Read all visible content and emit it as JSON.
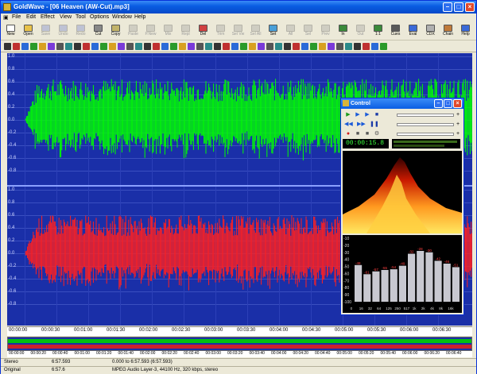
{
  "window": {
    "title": "GoldWave - [06 Heaven (AW-Cut).mp3]"
  },
  "menu": [
    "File",
    "Edit",
    "Effect",
    "View",
    "Tool",
    "Options",
    "Window",
    "Help"
  ],
  "toolbar": [
    {
      "label": "New",
      "color": "#ffffff",
      "disabled": false
    },
    {
      "label": "Open",
      "color": "#e8c24a",
      "disabled": false
    },
    {
      "label": "Save",
      "color": "#6a7ccf",
      "disabled": true
    },
    {
      "label": "Undo",
      "color": "#6a7ccf",
      "disabled": true
    },
    {
      "label": "Redo",
      "color": "#6a7ccf",
      "disabled": true
    },
    {
      "label": "Cut",
      "color": "#888888",
      "disabled": false
    },
    {
      "label": "Copy",
      "color": "#c2b36a",
      "disabled": false
    },
    {
      "label": "Paste",
      "color": "#9a9a9a",
      "disabled": true
    },
    {
      "label": "P.New",
      "color": "#9a9a9a",
      "disabled": true
    },
    {
      "label": "Mix",
      "color": "#9a9a9a",
      "disabled": true
    },
    {
      "label": "Repl",
      "color": "#9a9a9a",
      "disabled": true
    },
    {
      "label": "Del",
      "color": "#d04040",
      "disabled": false
    },
    {
      "label": "Trim",
      "color": "#9a9a9a",
      "disabled": true
    },
    {
      "label": "Sel Vw",
      "color": "#9a9a9a",
      "disabled": true
    },
    {
      "label": "Sel All",
      "color": "#9a9a9a",
      "disabled": true
    },
    {
      "label": "Set",
      "color": "#4aa0d8",
      "disabled": false
    },
    {
      "label": "All",
      "color": "#9a9a9a",
      "disabled": true
    },
    {
      "label": "Sel",
      "color": "#9a9a9a",
      "disabled": true
    },
    {
      "label": "Prev",
      "color": "#9a9a9a",
      "disabled": true
    },
    {
      "label": "In",
      "color": "#3a8a3a",
      "disabled": false
    },
    {
      "label": "Out",
      "color": "#9a9a9a",
      "disabled": true
    },
    {
      "label": "1:1",
      "color": "#3a8a3a",
      "disabled": false
    },
    {
      "label": "Cues",
      "color": "#5a5a5a",
      "disabled": false
    },
    {
      "label": "Eval",
      "color": "#3a6ad8",
      "disabled": false
    },
    {
      "label": "CDX",
      "color": "#b0b0b0",
      "disabled": false
    },
    {
      "label": "Chain",
      "color": "#c07a3a",
      "disabled": false
    },
    {
      "label": "Help",
      "color": "#3a6ad8",
      "disabled": false
    }
  ],
  "y_axis_labels": [
    "1.0",
    "0.8",
    "0.6",
    "0.4",
    "0.2",
    "0.0",
    "-0.2",
    "-0.4",
    "-0.6",
    "-0.8"
  ],
  "x_ruler": [
    "00:00:00",
    "00:00:30",
    "00:01:00",
    "00:01:30",
    "00:02:00",
    "00:02:30",
    "00:03:00",
    "00:03:30",
    "00:04:00",
    "00:04:30",
    "00:05:00",
    "00:05:30",
    "00:06:00",
    "00:06:30"
  ],
  "x_ruler_small": [
    "00:00:00",
    "00:00:20",
    "00:00:40",
    "00:01:00",
    "00:01:20",
    "00:01:40",
    "00:02:00",
    "00:02:20",
    "00:02:40",
    "00:03:00",
    "00:03:20",
    "00:03:40",
    "00:04:00",
    "00:04:20",
    "00:04:40",
    "00:05:00",
    "00:05:20",
    "00:05:40",
    "00:06:00",
    "00:06:20",
    "00:06:40"
  ],
  "control": {
    "title": "Control",
    "time": "00:00:15.8",
    "spectrum_db": [
      "-10",
      "-20",
      "-30",
      "-40",
      "-50",
      "-60",
      "-70",
      "-80",
      "-90",
      "-100"
    ],
    "spectrum_freq": [
      "0",
      "16",
      "32",
      "64",
      "125",
      "250",
      "517",
      "1k",
      "2k",
      "4k",
      "8k",
      "16k"
    ],
    "spectrum_values": [
      -48,
      -61,
      -57,
      -55,
      -54,
      -49,
      -32,
      -28,
      -30,
      -42,
      -46,
      -51
    ],
    "spectrum_value_labels": [
      "-48",
      "-61",
      "-57",
      "-55",
      "-54",
      "-49",
      "-32",
      "-28",
      "-30",
      "-42",
      "-46",
      "-51"
    ]
  },
  "status": {
    "row1": [
      "Stereo",
      "6:57.593",
      "0.000 to 6:57.593 (6:57.593)"
    ],
    "row2": [
      "Original",
      "6:57.6",
      "MPEG Audio Layer-3, 44100 Hz, 320 kbps, stereo"
    ]
  },
  "colors": {
    "left_channel": "#00ff00",
    "right_channel": "#ff2020",
    "background": "#1a2fa8"
  }
}
